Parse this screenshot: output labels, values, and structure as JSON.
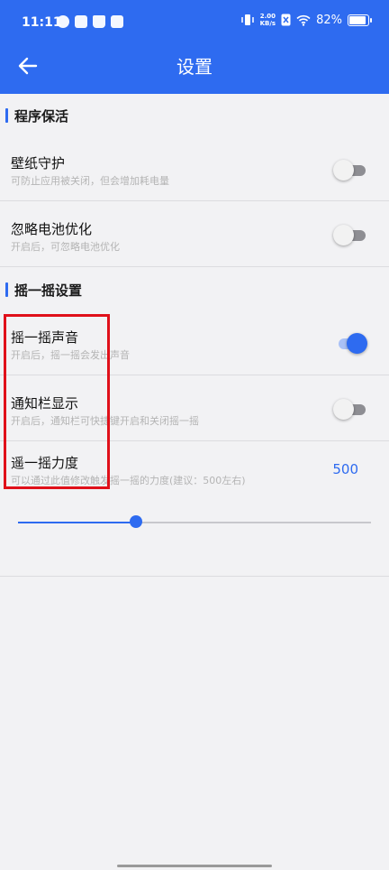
{
  "status_bar": {
    "time": "11:11",
    "net_speed_value": "2.00",
    "net_speed_unit": "KB/s",
    "battery": "82%"
  },
  "header": {
    "title": "设置"
  },
  "sections": {
    "keep_alive": {
      "label": "程序保活",
      "wallpaper": {
        "title": "壁纸守护",
        "desc": "可防止应用被关闭，但会增加耗电量",
        "enabled": false
      },
      "battery_opt": {
        "title": "忽略电池优化",
        "desc": "开启后，可忽略电池优化",
        "enabled": false
      }
    },
    "shake": {
      "label": "摇一摇设置",
      "sound": {
        "title": "摇一摇声音",
        "desc": "开启后，摇一摇会发出声音",
        "enabled": true
      },
      "notification": {
        "title": "通知栏显示",
        "desc": "开启后，通知栏可快捷键开启和关闭摇一摇",
        "enabled": false
      },
      "strength": {
        "title": "遥一摇力度",
        "desc": "可以通过此值修改触发摇一摇的力度(建议：500左右)",
        "value": "500",
        "slider_fraction": 0.335
      }
    }
  },
  "colors": {
    "accent": "#2e6bf0",
    "highlight": "#e0101a"
  }
}
